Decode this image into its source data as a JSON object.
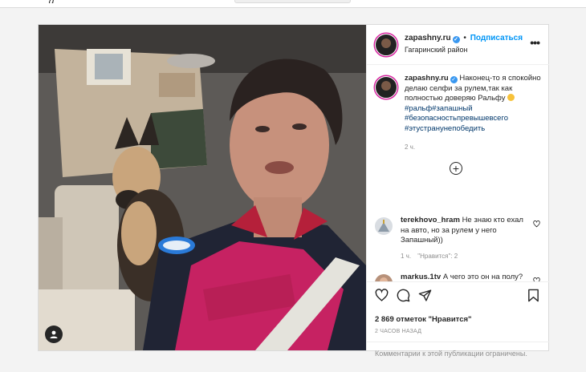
{
  "header": {
    "username": "zapashny.ru",
    "separator": "•",
    "follow_label": "Подписаться",
    "location": "Гагаринский район",
    "more_label": "•••"
  },
  "caption": {
    "username": "zapashny.ru",
    "text": "Наконец-то я спокойно делаю селфи за рулем,так как полностью доверяю Ральфу",
    "hashtags": [
      "#ральф#запашный",
      "#безопасностьпревышевсего",
      "#этустранунепобедить"
    ],
    "time": "2 ч."
  },
  "comments": [
    {
      "username": "terekhovo_hram",
      "text": "Не знаю кто ехал на авто, но за рулем у него Запашный))",
      "time": "1 ч.",
      "likes": "\"Нравится\": 2"
    },
    {
      "username": "markus.1tv",
      "text": "А чего это он на полу?"
    }
  ],
  "post": {
    "likes": "2 869 отметок \"Нравится\"",
    "posted_ago": "2 ЧАСОВ НАЗАД",
    "comments_restricted": "Комментарии к этой публикации ограничены."
  },
  "icons": [
    "heart-icon",
    "comment-icon",
    "share-icon",
    "bookmark-icon",
    "more-icon",
    "plus-circle-icon",
    "tag-user-icon",
    "verified-icon"
  ],
  "colors": {
    "link_blue": "#0095f6",
    "hashtag": "#00376b",
    "verified": "#3897f0",
    "muted": "#8e8e8e"
  }
}
